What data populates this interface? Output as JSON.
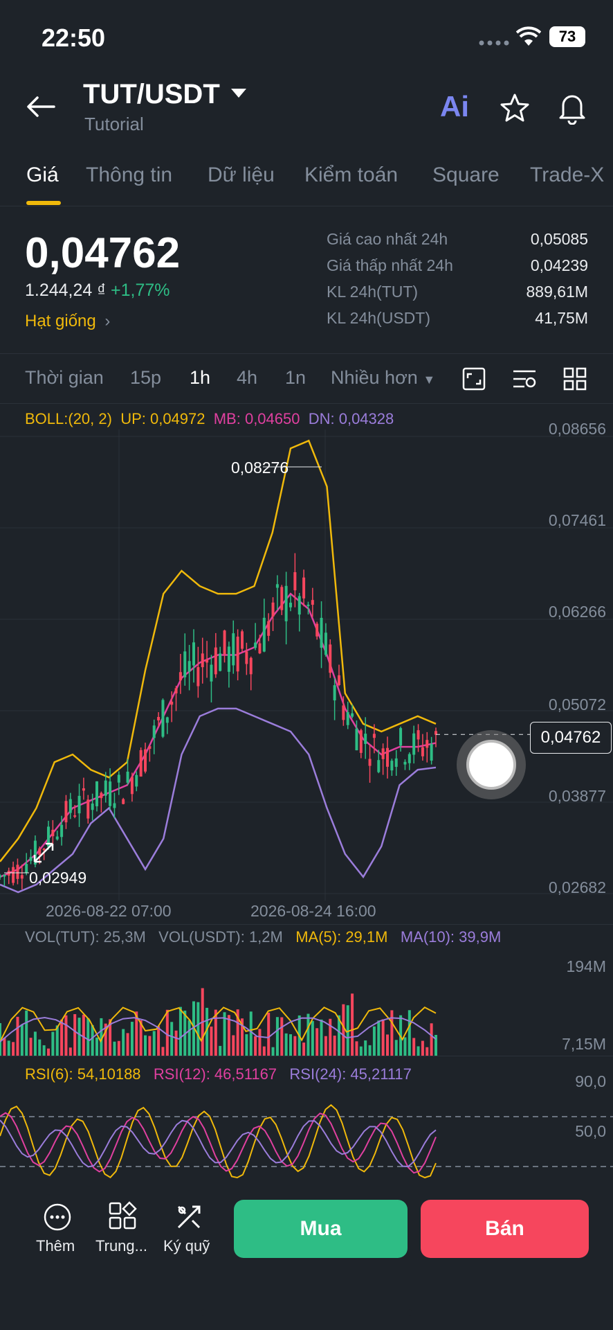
{
  "status": {
    "time": "22:50",
    "battery": "73"
  },
  "header": {
    "pair": "TUT/USDT",
    "name": "Tutorial",
    "ai_label": "Ai"
  },
  "tabs": [
    "Giá",
    "Thông tin",
    "Dữ liệu",
    "Kiểm toán",
    "Square",
    "Trade-X"
  ],
  "price": {
    "last": "0,04762",
    "fiat": "1.244,24 ₫",
    "change": "+1,77%",
    "tag": "Hạt giống",
    "stats": [
      {
        "label": "Giá cao nhất 24h",
        "value": "0,05085"
      },
      {
        "label": "Giá thấp nhất 24h",
        "value": "0,04239"
      },
      {
        "label": "KL 24h(TUT)",
        "value": "889,61M"
      },
      {
        "label": "KL 24h(USDT)",
        "value": "41,75M"
      }
    ]
  },
  "timeframes": [
    "Thời gian",
    "15p",
    "1h",
    "4h",
    "1n",
    "Nhiều hơn"
  ],
  "active_timeframe": "1h",
  "boll": {
    "label": "BOLL:(20, 2)",
    "up": "UP: 0,04972",
    "mb": "MB: 0,04650",
    "dn": "DN: 0,04328"
  },
  "price_axis": [
    "0,08656",
    "0,07461",
    "0,06266",
    "0,05072",
    "0,03877",
    "0,02682"
  ],
  "current_price_tag": "0,04762",
  "high_marker": "0,08276",
  "low_marker": "0,02949",
  "dates": [
    "2026-08-22 07:00",
    "2026-08-24 16:00"
  ],
  "volume": {
    "tut": "VOL(TUT): 25,3M",
    "usdt": "VOL(USDT): 1,2M",
    "ma5": "MA(5): 29,1M",
    "ma10": "MA(10): 39,9M",
    "axis_top": "194M",
    "axis_bottom": "7,15M"
  },
  "rsi": {
    "rsi6": "RSI(6): 54,10188",
    "rsi12": "RSI(12): 46,51167",
    "rsi24": "RSI(24): 45,21117",
    "axis_top": "90,0",
    "axis_mid": "50,0"
  },
  "bottom": {
    "more": "Thêm",
    "middle": "Trung...",
    "margin": "Ký quỹ",
    "buy": "Mua",
    "sell": "Bán"
  },
  "colors": {
    "up": "#2ebd85",
    "down": "#f6465d",
    "accent": "#f0b90b",
    "boll_up": "#f0b90b",
    "boll_mb": "#e040a0",
    "boll_dn": "#9b7ddb"
  },
  "chart_data": {
    "type": "candlestick",
    "title": "",
    "ylim": [
      0.02682,
      0.08656
    ],
    "x_ticks": [
      "2026-08-22 07:00",
      "2026-08-24 16:00"
    ],
    "last": 0.04762,
    "high": 0.08276,
    "low": 0.02949,
    "series": [
      {
        "name": "UP",
        "values": [
          0.031,
          0.034,
          0.038,
          0.044,
          0.045,
          0.043,
          0.042,
          0.044,
          0.056,
          0.066,
          0.069,
          0.067,
          0.066,
          0.066,
          0.067,
          0.074,
          0.085,
          0.086,
          0.08,
          0.053,
          0.049,
          0.048,
          0.049,
          0.05,
          0.049
        ]
      },
      {
        "name": "MB",
        "values": [
          0.029,
          0.03,
          0.032,
          0.035,
          0.038,
          0.039,
          0.04,
          0.041,
          0.045,
          0.05,
          0.055,
          0.057,
          0.058,
          0.058,
          0.059,
          0.063,
          0.066,
          0.064,
          0.058,
          0.051,
          0.047,
          0.045,
          0.046,
          0.046,
          0.0465
        ]
      },
      {
        "name": "DN",
        "values": [
          0.028,
          0.027,
          0.028,
          0.03,
          0.032,
          0.036,
          0.038,
          0.034,
          0.03,
          0.034,
          0.045,
          0.05,
          0.051,
          0.051,
          0.05,
          0.049,
          0.048,
          0.045,
          0.038,
          0.032,
          0.029,
          0.033,
          0.041,
          0.043,
          0.0433
        ]
      }
    ]
  }
}
